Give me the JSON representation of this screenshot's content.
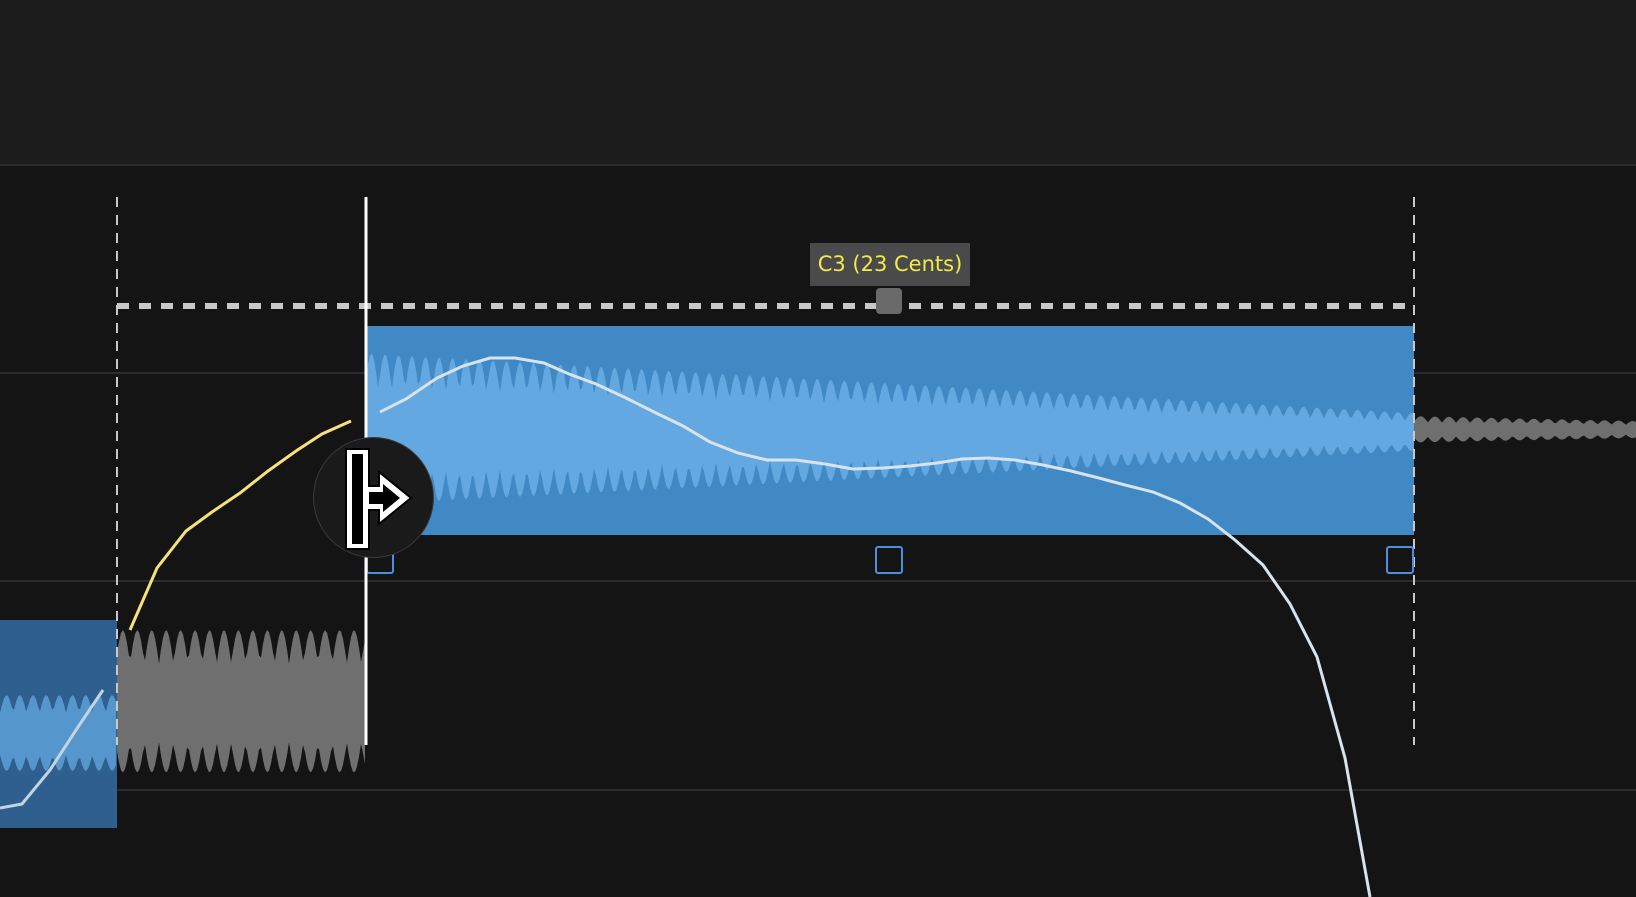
{
  "editor": {
    "pitch_label": "C3 (23 Cents)",
    "active_tool": "split-tool-icon"
  },
  "colors": {
    "background": "#1c1c1d",
    "lane_background": "#141415",
    "region_blue": "#4189c4",
    "region_blue_dark": "#2f5f8f",
    "waveform_blue": "#63a8e0",
    "waveform_gray": "#6f6f6f",
    "selection_dash": "#c8c8c8",
    "playhead": "#ffffff",
    "pitch_label_text": "#f2e94a",
    "pitch_label_bg": "#4a4a4a",
    "pitch_curve": "#dbe6f0",
    "pitch_curve_selected": "#f5e27a",
    "handle_outline": "#4a8fe0"
  }
}
